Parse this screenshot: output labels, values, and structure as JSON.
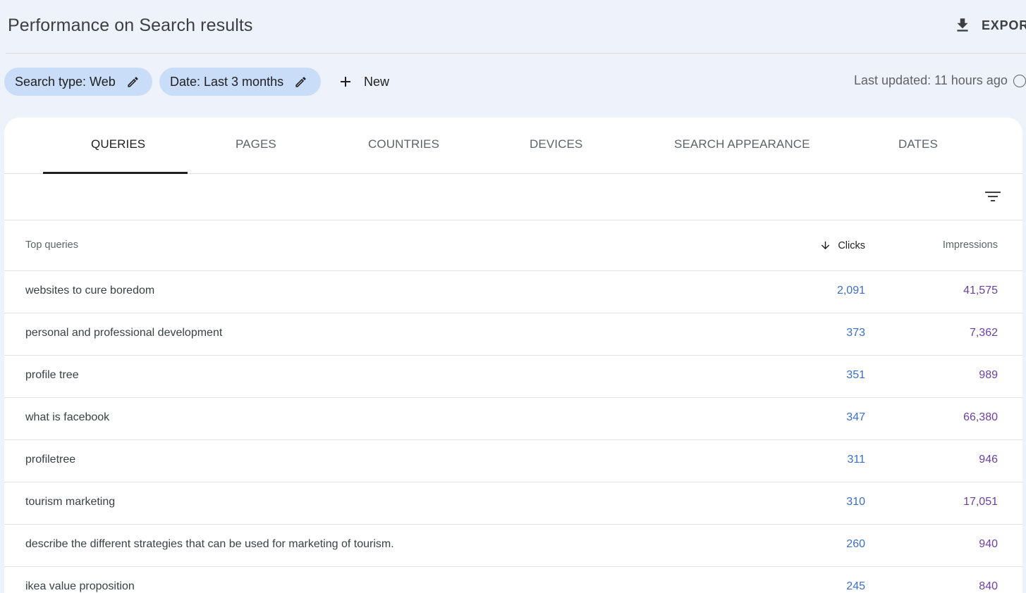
{
  "header": {
    "title": "Performance on Search results",
    "export_label": "EXPORT"
  },
  "filters": {
    "search_type": "Search type: Web",
    "date": "Date: Last 3 months",
    "new_label": "New",
    "last_updated": "Last updated: 11 hours ago"
  },
  "tabs": [
    {
      "label": "QUERIES",
      "active": true
    },
    {
      "label": "PAGES",
      "active": false
    },
    {
      "label": "COUNTRIES",
      "active": false
    },
    {
      "label": "DEVICES",
      "active": false
    },
    {
      "label": "SEARCH APPEARANCE",
      "active": false
    },
    {
      "label": "DATES",
      "active": false
    }
  ],
  "table": {
    "headers": {
      "query": "Top queries",
      "clicks": "Clicks",
      "impressions": "Impressions"
    },
    "sort": {
      "column": "clicks",
      "direction": "desc"
    },
    "rows": [
      {
        "query": "websites to cure boredom",
        "clicks": "2,091",
        "impressions": "41,575"
      },
      {
        "query": "personal and professional development",
        "clicks": "373",
        "impressions": "7,362"
      },
      {
        "query": "profile tree",
        "clicks": "351",
        "impressions": "989"
      },
      {
        "query": "what is facebook",
        "clicks": "347",
        "impressions": "66,380"
      },
      {
        "query": "profiletree",
        "clicks": "311",
        "impressions": "946"
      },
      {
        "query": "tourism marketing",
        "clicks": "310",
        "impressions": "17,051"
      },
      {
        "query": "describe the different strategies that can be used for marketing of tourism.",
        "clicks": "260",
        "impressions": "940"
      },
      {
        "query": "ikea value proposition",
        "clicks": "245",
        "impressions": "840"
      }
    ]
  },
  "colors": {
    "background": "#eef3fb",
    "chip": "#c9dcf8",
    "clicks": "#3a6ec8",
    "impressions": "#6b3fa0"
  },
  "icons": {
    "export": "download-icon",
    "edit": "pencil-icon",
    "new": "plus-icon",
    "help": "help-circle-icon",
    "filter": "filter-lines-icon",
    "sort": "arrow-down-icon"
  }
}
